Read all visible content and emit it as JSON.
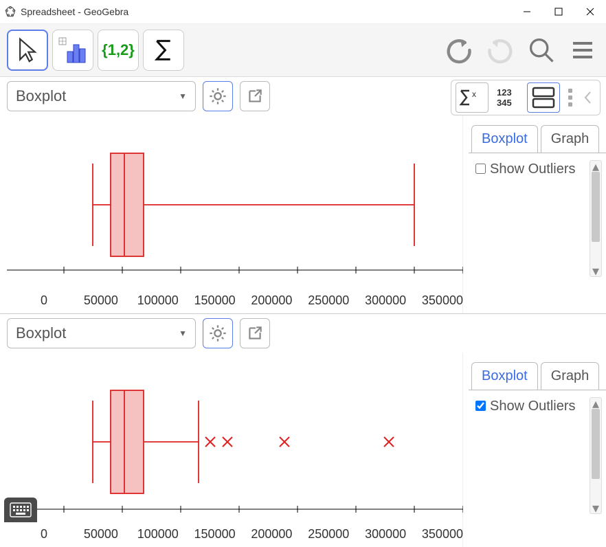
{
  "window": {
    "title": "Spreadsheet - GeoGebra"
  },
  "toolbar": {
    "tool_list": "{1,2}"
  },
  "plot1": {
    "dropdown": "Boxplot",
    "tabs": {
      "boxplot": "Boxplot",
      "graph": "Graph"
    },
    "show_outliers_label": "Show Outliers",
    "show_outliers_checked": false,
    "axis": [
      "0",
      "50000",
      "100000",
      "150000",
      "200000",
      "250000",
      "300000",
      "350000"
    ]
  },
  "plot2": {
    "dropdown": "Boxplot",
    "tabs": {
      "boxplot": "Boxplot",
      "graph": "Graph"
    },
    "show_outliers_label": "Show Outliers",
    "show_outliers_checked": true,
    "axis": [
      "0",
      "50000",
      "100000",
      "150000",
      "200000",
      "250000",
      "300000",
      "350000"
    ]
  },
  "chart_data": [
    {
      "type": "boxplot",
      "title": "Boxplot (without outliers)",
      "xlim": [
        0,
        360000
      ],
      "min": 25000,
      "q1": 40000,
      "median": 52000,
      "q3": 68000,
      "max": 300000,
      "outliers": []
    },
    {
      "type": "boxplot",
      "title": "Boxplot (with outliers)",
      "xlim": [
        0,
        360000
      ],
      "min": 25000,
      "q1": 40000,
      "median": 52000,
      "q3": 68000,
      "max": 115000,
      "outliers": [
        125000,
        140000,
        175000,
        240000
      ]
    }
  ]
}
